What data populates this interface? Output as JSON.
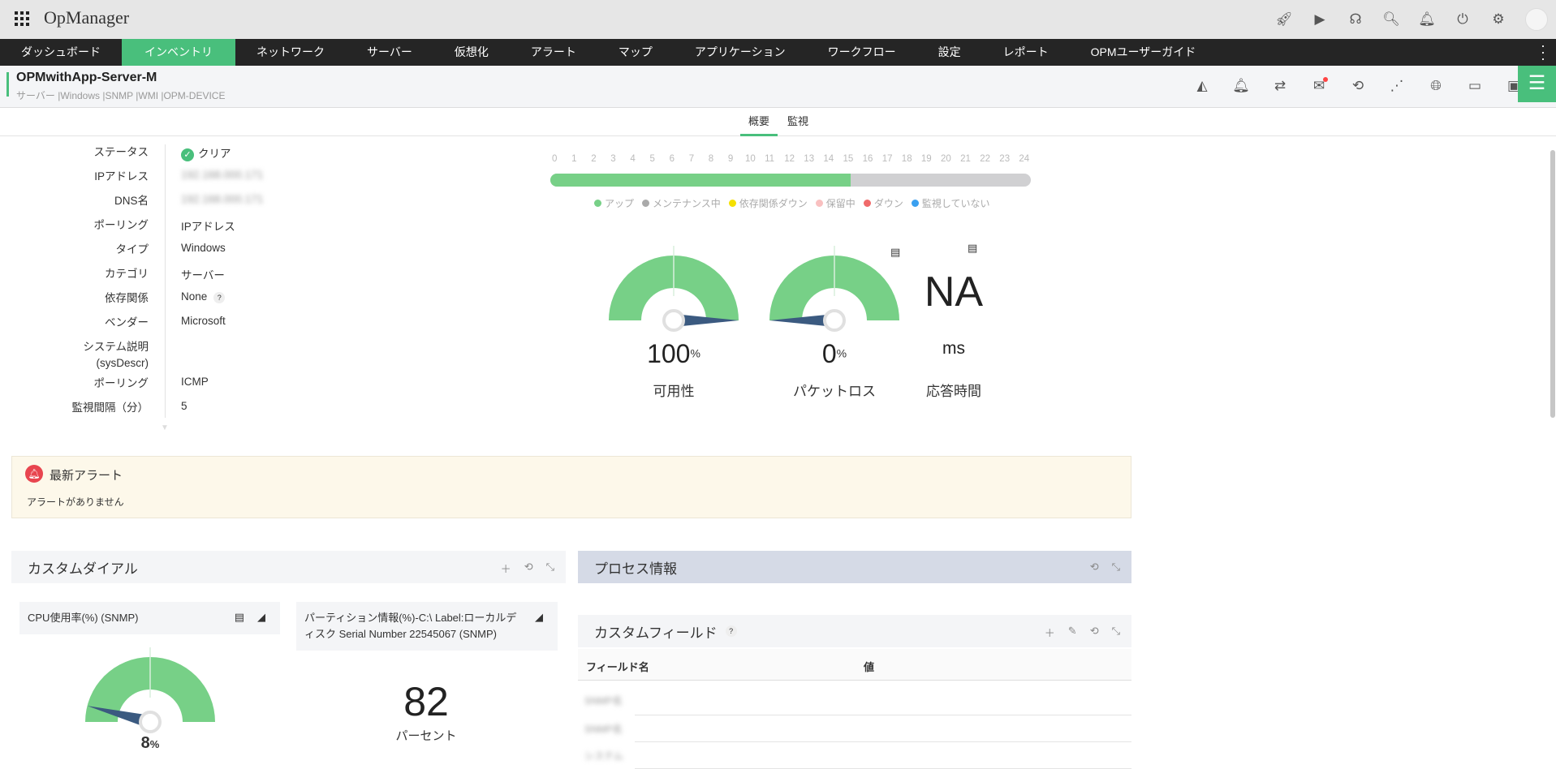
{
  "app": {
    "title": "OpManager"
  },
  "top_icons": [
    "rocket-icon",
    "presentation-icon",
    "headset-icon",
    "search-icon",
    "bell-icon",
    "plug-icon",
    "gear-icon",
    "avatar"
  ],
  "nav": {
    "items": [
      "ダッシュボード",
      "インベントリ",
      "ネットワーク",
      "サーバー",
      "仮想化",
      "アラート",
      "マップ",
      "アプリケーション",
      "ワークフロー",
      "設定",
      "レポート",
      "OPMユーザーガイド"
    ],
    "active": 1
  },
  "device": {
    "name": "OPMwithApp-Server-M",
    "tags": "サーバー |Windows |SNMP |WMI |OPM-DEVICE"
  },
  "tabs": [
    "概要",
    "監視"
  ],
  "info": [
    {
      "label": "ステータス",
      "value": "クリア"
    },
    {
      "label": "IPアドレス",
      "value": "192.168.000.171"
    },
    {
      "label": "DNS名",
      "value": "192.168.000.171"
    },
    {
      "label": "ポーリング",
      "value": "IPアドレス"
    },
    {
      "label": "タイプ",
      "value": "Windows"
    },
    {
      "label": "カテゴリ",
      "value": "サーバー"
    },
    {
      "label": "依存関係",
      "value": "None"
    },
    {
      "label": "ベンダー",
      "value": "Microsoft"
    },
    {
      "label": "システム説明",
      "label2": "(sysDescr)",
      "value": ""
    },
    {
      "label": "ポーリング",
      "value": "ICMP"
    },
    {
      "label": "監視間隔（分）",
      "value": "5"
    }
  ],
  "timeline": {
    "hours": [
      "0",
      "1",
      "2",
      "3",
      "4",
      "5",
      "6",
      "7",
      "8",
      "9",
      "10",
      "11",
      "12",
      "13",
      "14",
      "15",
      "16",
      "17",
      "18",
      "19",
      "20",
      "21",
      "22",
      "23",
      "24"
    ],
    "up_until_hour": 15,
    "legend": [
      {
        "label": "アップ",
        "color": "#77d087"
      },
      {
        "label": "メンテナンス中",
        "color": "#aaaaaa"
      },
      {
        "label": "依存関係ダウン",
        "color": "#f5e000"
      },
      {
        "label": "保留中",
        "color": "#f9c0c0"
      },
      {
        "label": "ダウン",
        "color": "#f06a6a"
      },
      {
        "label": "監視していない",
        "color": "#3aa0f0"
      }
    ]
  },
  "gauges": {
    "availability": {
      "value": "100",
      "unit": "%",
      "label": "可用性",
      "fraction": 1.0
    },
    "packet_loss": {
      "value": "0",
      "unit": "%",
      "label": "パケットロス",
      "fraction": 0.0
    },
    "response_time": {
      "value": "NA",
      "unit": "ms",
      "label": "応答時間"
    }
  },
  "alerts": {
    "title": "最新アラート",
    "empty": "アラートがありません"
  },
  "custom_dial": {
    "title": "カスタムダイアル",
    "cpu": {
      "title": "CPU使用率(%) (SNMP)",
      "value": "8",
      "unit": "%",
      "fraction": 0.08
    },
    "partition": {
      "title": "パーティション情報(%)-C:\\ Label:ローカルディスク Serial Number 22545067 (SNMP)",
      "value": "82",
      "unit": "パーセント"
    }
  },
  "process": {
    "title": "プロセス情報"
  },
  "custom_fields": {
    "title": "カスタムフィールド",
    "columns": [
      "フィールド名",
      "値"
    ],
    "rows": [
      "SNMP名",
      "SNMP名",
      "システム"
    ]
  }
}
